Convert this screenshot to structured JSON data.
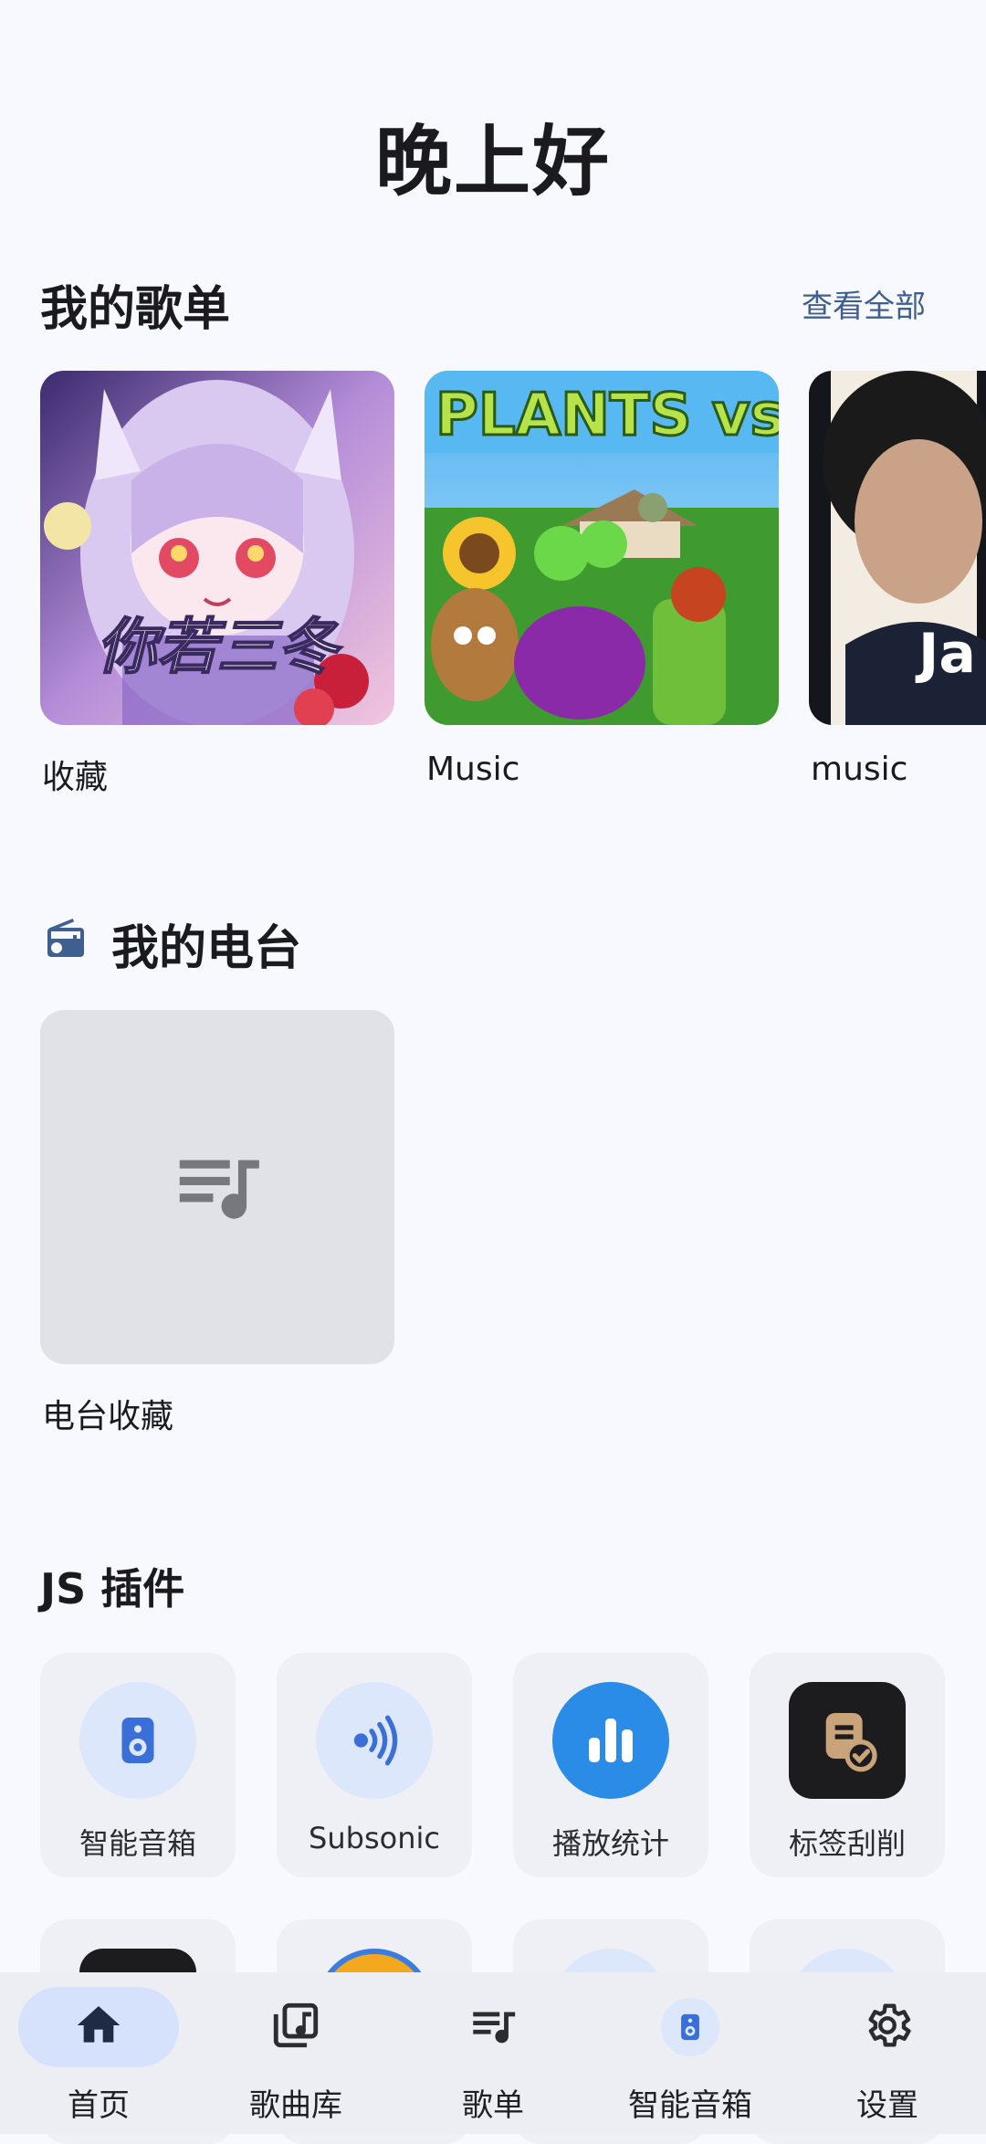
{
  "greeting": "晚上好",
  "playlists_section": {
    "title": "我的歌单",
    "view_all": "查看全部",
    "items": [
      {
        "label": "收藏",
        "cover_text": "你若三冬"
      },
      {
        "label": "Music",
        "cover_text": "PLANTS vs. ZOMBIES"
      },
      {
        "label": "music",
        "cover_text": "Ja 周"
      }
    ]
  },
  "radio_section": {
    "title": "我的电台",
    "icon": "radio-icon",
    "items": [
      {
        "label": "电台收藏",
        "icon": "playlist-music-icon"
      }
    ]
  },
  "plugins_section": {
    "title": "JS 插件",
    "items": [
      {
        "label": "智能音箱",
        "icon": "speaker-icon"
      },
      {
        "label": "Subsonic",
        "icon": "subsonic-icon"
      },
      {
        "label": "播放统计",
        "icon": "bar-chart-icon"
      },
      {
        "label": "标签刮削",
        "icon": "tag-scrape-icon"
      }
    ]
  },
  "bottom_nav": {
    "items": [
      {
        "label": "首页",
        "icon": "home-icon",
        "active": true
      },
      {
        "label": "歌曲库",
        "icon": "music-library-icon",
        "active": false
      },
      {
        "label": "歌单",
        "icon": "playlist-icon",
        "active": false
      },
      {
        "label": "智能音箱",
        "icon": "speaker-icon",
        "active": false
      },
      {
        "label": "设置",
        "icon": "gear-icon",
        "active": false
      }
    ]
  },
  "colors": {
    "background": "#f8f9fe",
    "accent": "#3f5f91",
    "nav_active": "#d6e2fb",
    "tile": "#eff0f6"
  }
}
